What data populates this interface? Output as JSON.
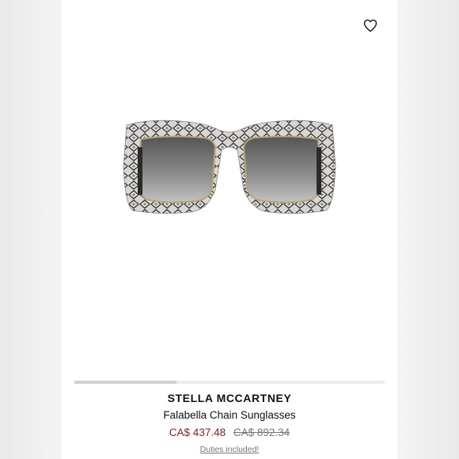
{
  "product": {
    "brand": "STELLA MCCARTNEY",
    "name": "Falabella Chain Sunglasses",
    "sale_price": "CA$ 437.48",
    "original_price": "CA$ 892.34",
    "duties_link": "Duties included!"
  },
  "icons": {
    "favorite": "heart-outline-icon"
  },
  "carousel": {
    "current_image": 1,
    "progress": 0.33
  },
  "colors": {
    "sale_price": "#8a1f1f",
    "original_price": "#777777",
    "background": "#ffffff"
  }
}
